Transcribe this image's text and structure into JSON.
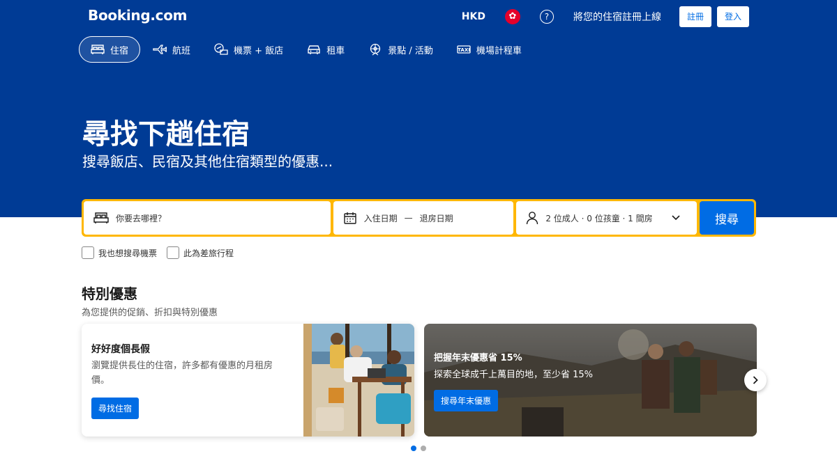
{
  "header": {
    "logo": "Booking.com",
    "currency": "HKD",
    "flag_icon": "hong-kong-flag-icon",
    "help_icon": "question-circle-icon",
    "list_property": "將您的住宿註冊上線",
    "register": "註冊",
    "login": "登入"
  },
  "nav": {
    "items": [
      {
        "label": "住宿",
        "icon": "bed-icon",
        "active": true
      },
      {
        "label": "航班",
        "icon": "plane-icon"
      },
      {
        "label": "機票 + 飯店",
        "icon": "plane-bed-icon"
      },
      {
        "label": "租車",
        "icon": "car-icon"
      },
      {
        "label": "景點 / 活動",
        "icon": "attractions-icon"
      },
      {
        "label": "機場計程車",
        "icon": "taxi-icon"
      }
    ]
  },
  "hero": {
    "title": "尋找下趟住宿",
    "subtitle": "搜尋飯店、民宿及其他住宿類型的優惠..."
  },
  "search": {
    "destination_placeholder": "你要去哪裡？",
    "checkin": "入住日期",
    "separator": "—",
    "checkout": "退房日期",
    "occupancy": "2 位成人 · 0 位孩童 · 1 間房",
    "submit": "搜尋",
    "accent_color": "#ffb700"
  },
  "options": {
    "flights": "我也想搜尋機票",
    "business": "此為差旅行程"
  },
  "offers": {
    "title": "特別優惠",
    "subtitle": "為您提供的促銷、折扣與特別優惠",
    "card1": {
      "title": "好好度個長假",
      "description": "瀏覽提供長住的住宿，許多都有優惠的月租房價。",
      "button": "尋找住宿"
    },
    "card2": {
      "title": "把握年末優惠省 15%",
      "description": "探索全球成千上萬目的地，至少省 15%",
      "button": "搜尋年末優惠"
    }
  },
  "colors": {
    "brand_blue": "#003b95",
    "button_blue": "#006ce4"
  }
}
